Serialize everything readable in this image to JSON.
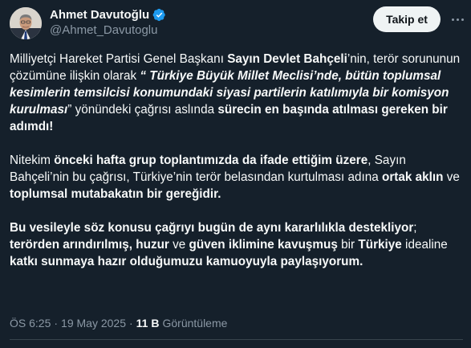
{
  "author": {
    "display_name": "Ahmet Davutoğlu",
    "handle": "@Ahmet_Davutoglu",
    "verified_icon": "verified-badge-icon",
    "avatar_icon": "profile-photo"
  },
  "actions": {
    "follow_label": "Takip et",
    "more_icon": "more-options-icon"
  },
  "tweet": {
    "p1": [
      {
        "t": "Milliyetçi Hareket Partisi Genel Başkanı "
      },
      {
        "t": "Sayın Devlet Bahçeli",
        "b": true
      },
      {
        "t": "’nin, terör sorununun çözümüne ilişkin olarak "
      },
      {
        "t": "“ Türkiye Büyük Millet Meclisi’nde, bütün toplumsal kesimlerin temsilcisi konumundaki siyasi partilerin katılımıyla bir komisyon kurulması",
        "b": true,
        "i": true
      },
      {
        "t": "” yönündeki çağrısı aslında "
      },
      {
        "t": "sürecin en başında atılması gereken bir adımdı!",
        "b": true
      }
    ],
    "p2": [
      {
        "t": "Nitekim "
      },
      {
        "t": "önceki hafta grup toplantımızda da ifade ettiğim üzere",
        "b": true
      },
      {
        "t": ", Sayın Bahçeli’nin bu çağrısı, Türkiye’nin terör belasından kurtulması adına "
      },
      {
        "t": "ortak aklın",
        "b": true
      },
      {
        "t": " ve "
      },
      {
        "t": "toplumsal mutabakatın bir gereğidir.",
        "b": true
      }
    ],
    "p3": [
      {
        "t": "Bu vesileyle söz konusu çağrıyı bugün de aynı kararlılıkla destekliyor",
        "b": true
      },
      {
        "t": "; "
      },
      {
        "t": "terörden arındırılmış, huzur",
        "b": true
      },
      {
        "t": " ve "
      },
      {
        "t": "güven iklimine kavuşmuş",
        "b": true
      },
      {
        "t": " bir "
      },
      {
        "t": "Türkiye",
        "b": true
      },
      {
        "t": " idealine "
      },
      {
        "t": "katkı sunmaya hazır olduğumuzu kamuoyuyla paylaşıyorum.",
        "b": true
      }
    ]
  },
  "meta": {
    "time": "ÖS 6:25",
    "separator1": "·",
    "date": "19 May 2025",
    "separator2": "·",
    "views_count": "11 B",
    "views_label": "Görüntüleme"
  },
  "colors": {
    "background": "#15202b",
    "text": "#f7f9f9",
    "secondary": "#8b98a5",
    "verified": "#1d9bf0",
    "follow_bg": "#eff3f4"
  }
}
